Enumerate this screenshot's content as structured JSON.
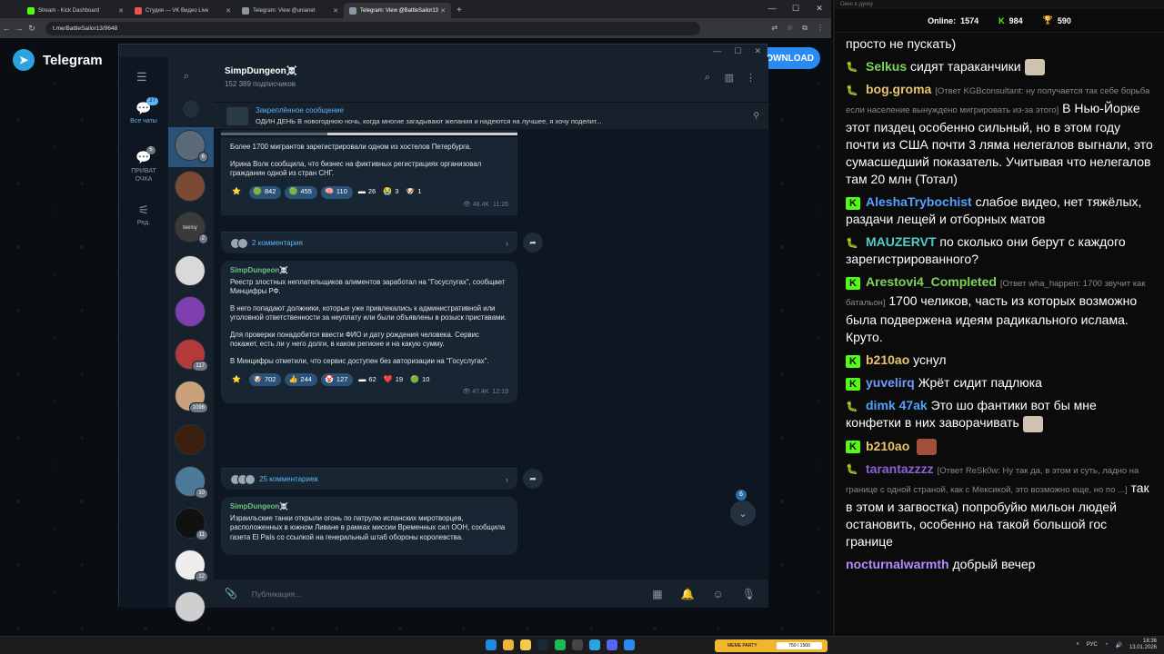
{
  "browser": {
    "tabs": [
      {
        "title": "Stream - Kick Dashboard",
        "color": "#53fc18"
      },
      {
        "title": "Студия — VK Видео Live",
        "color": "#e8554e"
      },
      {
        "title": "Telegram: View @unianet",
        "color": "#8a97a3"
      },
      {
        "title": "Telegram: View @BattleSailor13",
        "color": "#8a97a3"
      }
    ],
    "url": "t.me/BattleSailor13/9648"
  },
  "tgweb": {
    "logo": "Telegram",
    "download": "DOWNLOAD"
  },
  "folders": [
    {
      "label": "Все чаты",
      "badge": "27",
      "icon": "chat-bubble-icon"
    },
    {
      "label": "ПРИВАТ ОЧКА",
      "badge": "5",
      "icon": "chat-bubble-icon"
    },
    {
      "label": "Ред.",
      "badge": "",
      "icon": "sliders-icon"
    }
  ],
  "chatlist": {
    "badges": [
      "6",
      "",
      "2",
      "",
      "",
      "117",
      "1096",
      "",
      "10",
      "11",
      "12",
      ""
    ],
    "mini_label": "teelsy"
  },
  "channel": {
    "name": "SimpDungeon☠️",
    "subs": "152 389 подписчиков",
    "pinned_title": "Закреплённое сообщение",
    "pinned_text": "ОДИН ДЕНЬ  В новогоднюю ночь, когда многие загадывают желания и надеются на лучшее, я хочу поделит..."
  },
  "messages": [
    {
      "sender": "",
      "paragraphs": [
        "Более 1700 мигрантов зарегистрировали одном из хостелов Петербурга.",
        "Ирина Волк сообщила, что бизнес на фиктивных регистрациях организовал гражданин одной из стран СНГ."
      ],
      "reactions": [
        {
          "emoji": "⭐",
          "count": "",
          "plain": true
        },
        {
          "emoji": "🟢",
          "count": "842"
        },
        {
          "emoji": "🟢",
          "count": "455"
        },
        {
          "emoji": "🧠",
          "count": "110"
        },
        {
          "emoji": "▬",
          "count": "26",
          "plain": true
        },
        {
          "emoji": "😭",
          "count": "3",
          "plain": true
        },
        {
          "emoji": "🐶",
          "count": "1",
          "plain": true
        }
      ],
      "views": "48.4K",
      "time": "11:26",
      "comments": "2 комментария"
    },
    {
      "sender": "SimpDungeon☠️",
      "paragraphs": [
        "Реестр злостных неплательщиков алиментов заработал на \"Госуслугах\", сообщает Минцифры РФ.",
        "В него попадают должники, которые уже привлекались к административной или уголовной ответственности за неуплату или были объявлены в розыск приставами.",
        "Для проверки понадобится ввести ФИО и дату рождения человека. Сервис покажет, есть ли у него долги, в каком регионе и на какую сумму.",
        "В Минцифры отметили, что сервис доступен без авторизации на \"Госуслугах\"."
      ],
      "reactions": [
        {
          "emoji": "⭐",
          "count": "",
          "plain": true
        },
        {
          "emoji": "🐶",
          "count": "702"
        },
        {
          "emoji": "👍",
          "count": "244"
        },
        {
          "emoji": "🤡",
          "count": "127"
        },
        {
          "emoji": "▬",
          "count": "62",
          "plain": true
        },
        {
          "emoji": "❤️",
          "count": "19",
          "plain": true
        },
        {
          "emoji": "🟢",
          "count": "10",
          "plain": true
        }
      ],
      "views": "47.4K",
      "time": "12:19",
      "comments": "25 комментариев"
    },
    {
      "sender": "SimpDungeon☠️",
      "paragraphs": [
        "Израильские танки открыли огонь по патрулю испанских миротворцев, расположенных в южном Ливане в рамках миссии Временных сил ООН, сообщила газета El País со ссылкой на генеральный штаб обороны королевства."
      ]
    }
  ],
  "scroll_badge": "6",
  "composer_placeholder": "Публикация...",
  "side": {
    "header": "Окно в дуику",
    "online_label": "Online:",
    "online": "1574",
    "followers": "984",
    "subs": "590",
    "messages": [
      {
        "user": "",
        "reply": "",
        "text": "просто не пускать)",
        "badge": "none",
        "color": "#ffffff"
      },
      {
        "user": "Selkus",
        "reply": "",
        "text": "сидят тараканчики",
        "badge": "worm",
        "color": "#7fd35b",
        "emote": true
      },
      {
        "user": "bog.groma",
        "reply": "[Ответ KGBconsultant: ну получается так себе борьба если население вынуждено мигрировать из-за этого]",
        "text": "В Нью-Йорке этот пиздец особенно сильный, но в этом году почти из США почти 3 ляма нелегалов выгнали, это сумасшедший показатель. Учитывая что нелегалов там 20 млн (Тотал)",
        "badge": "worm",
        "color": "#e9c46a"
      },
      {
        "user": "AleshaTrybochist",
        "reply": "",
        "text": "слабое видео, нет тяжёлых, раздачи лещей и отборных матов",
        "badge": "k",
        "color": "#4fa3ff"
      },
      {
        "user": "MAUZERVT",
        "reply": "",
        "text": "по сколько они берут с каждого зарегистрированного?",
        "badge": "worm",
        "color": "#4ecdc4"
      },
      {
        "user": "Arestovi4_Completed",
        "reply": "[Ответ wha_happen: 1700 звучит как батальон]",
        "text": "1700 челиков, часть из которых возможно была подвержена идеям радикального ислама. Круто.",
        "badge": "k",
        "color": "#7fd35b"
      },
      {
        "user": "b210ao",
        "reply": "",
        "text": "уснул",
        "badge": "k",
        "color": "#e9c46a"
      },
      {
        "user": "yuvelirq",
        "reply": "",
        "text": "Жрёт сидит падлюка",
        "badge": "k",
        "color": "#6f9bff"
      },
      {
        "user": "dimk 47ak",
        "reply": "",
        "text": "Это шо фантики вот бы мне конфетки в них заворачивать",
        "badge": "worm",
        "color": "#4fa3ff",
        "emote": true
      },
      {
        "user": "b210ao",
        "reply": "",
        "text": "",
        "badge": "k",
        "color": "#e9c46a",
        "emote": true
      },
      {
        "user": "tarantazzzz",
        "reply": "[Ответ ReSk0w: Ну так да, в этом и суть, ладно на границе с одной страной, как с Мексикой, это возможно еще, но по ...]",
        "text": "так в этом и загвостка) попробуйю мильон людей остановить, особенно на такой большой гос границе",
        "badge": "worm",
        "color": "#8a63d2"
      },
      {
        "user": "nocturnalwarmth",
        "reply": "",
        "text": "добрый вечер",
        "badge": "none",
        "color": "#b58cff"
      }
    ]
  },
  "taskbar": {
    "media_label": "MEME PARTY",
    "media_progress": "750 / 1500",
    "lang": "РУС",
    "time": "18:36",
    "date": "13.01.2026"
  }
}
